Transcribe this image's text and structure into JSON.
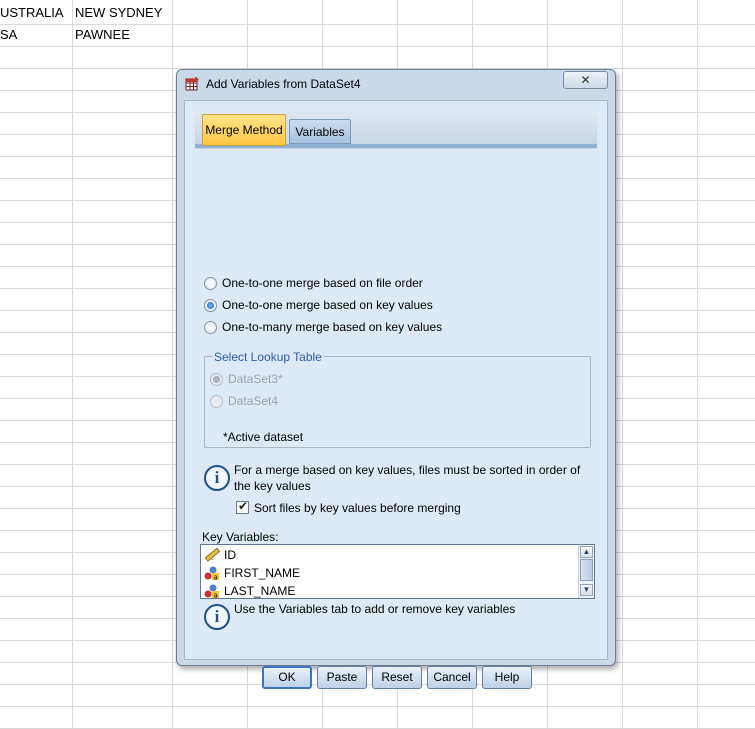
{
  "spreadsheet": {
    "rows": [
      {
        "col1": "USTRALIA",
        "col2": "NEW SYDNEY"
      },
      {
        "col1": "SA",
        "col2": "PAWNEE"
      }
    ]
  },
  "dialog": {
    "title": "Add Variables from DataSet4",
    "close_glyph": "✕",
    "tabs": [
      {
        "label": "Merge Method",
        "active": true
      },
      {
        "label": "Variables",
        "active": false
      }
    ],
    "merge_options": [
      {
        "label": "One-to-one merge based on file order",
        "checked": false
      },
      {
        "label": "One-to-one merge based on key values",
        "checked": true
      },
      {
        "label": "One-to-many merge based on key values",
        "checked": false
      }
    ],
    "lookup": {
      "legend": "Select Lookup Table",
      "options": [
        {
          "label": "DataSet3*",
          "checked": true
        },
        {
          "label": "DataSet4",
          "checked": false
        }
      ],
      "note": "*Active dataset"
    },
    "sort_info": "For a merge based on key values, files must be sorted in order of the key values",
    "sort_checkbox": {
      "label": "Sort files by key values before merging",
      "checked": true
    },
    "key_variables": {
      "label": "Key Variables:",
      "items": [
        {
          "name": "ID",
          "icon": "ruler-scale-icon"
        },
        {
          "name": "FIRST_NAME",
          "icon": "nominal-variable-icon"
        },
        {
          "name": "LAST_NAME",
          "icon": "nominal-variable-icon"
        }
      ]
    },
    "key_info": "Use the Variables tab to add or remove key variables",
    "buttons": {
      "ok": "OK",
      "paste": "Paste",
      "reset": "Reset",
      "cancel": "Cancel",
      "help": "Help"
    }
  }
}
